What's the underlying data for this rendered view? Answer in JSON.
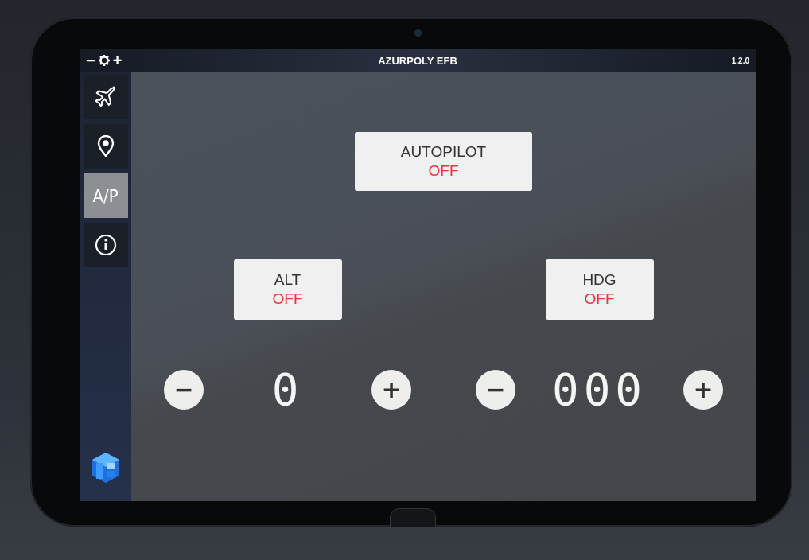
{
  "top_bar": {
    "zoom_out": "−",
    "zoom_in": "+",
    "title": "AZURPOLY EFB",
    "version": "1.2.0"
  },
  "sidebar": {
    "items": [
      {
        "kind": "plane",
        "selected": false
      },
      {
        "kind": "pin",
        "selected": false
      },
      {
        "kind": "text",
        "label": "A/P",
        "selected": true
      },
      {
        "kind": "info",
        "selected": false
      }
    ]
  },
  "autopilot": {
    "label": "AUTOPILOT",
    "status": "OFF",
    "on": false
  },
  "controls": [
    {
      "label": "ALT",
      "status": "OFF",
      "on": false,
      "decrement": "−",
      "display": "0",
      "increment": "+"
    },
    {
      "label": "HDG",
      "status": "OFF",
      "on": false,
      "decrement": "−",
      "display": "000",
      "increment": "+"
    }
  ]
}
